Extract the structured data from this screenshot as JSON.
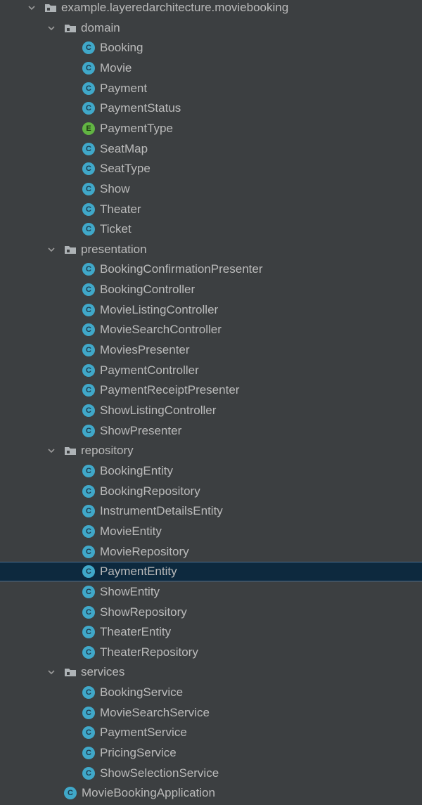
{
  "colors": {
    "background": "#3c3f41",
    "text": "#bbbbbb",
    "selection": "#0d293e",
    "class_icon": "#40a8c9",
    "enum_icon": "#62b543"
  },
  "tree": [
    {
      "label": "example.layeredarchitecture.moviebooking",
      "kind": "package",
      "depth": 0,
      "expanded": true
    },
    {
      "label": "domain",
      "kind": "package",
      "depth": 1,
      "expanded": true
    },
    {
      "label": "Booking",
      "kind": "class",
      "depth": 2
    },
    {
      "label": "Movie",
      "kind": "class",
      "depth": 2
    },
    {
      "label": "Payment",
      "kind": "class",
      "depth": 2
    },
    {
      "label": "PaymentStatus",
      "kind": "class",
      "depth": 2
    },
    {
      "label": "PaymentType",
      "kind": "enum",
      "depth": 2
    },
    {
      "label": "SeatMap",
      "kind": "class",
      "depth": 2
    },
    {
      "label": "SeatType",
      "kind": "class",
      "depth": 2
    },
    {
      "label": "Show",
      "kind": "class",
      "depth": 2
    },
    {
      "label": "Theater",
      "kind": "class",
      "depth": 2
    },
    {
      "label": "Ticket",
      "kind": "class",
      "depth": 2
    },
    {
      "label": "presentation",
      "kind": "package",
      "depth": 1,
      "expanded": true
    },
    {
      "label": "BookingConfirmationPresenter",
      "kind": "class",
      "depth": 2
    },
    {
      "label": "BookingController",
      "kind": "class",
      "depth": 2
    },
    {
      "label": "MovieListingController",
      "kind": "class",
      "depth": 2
    },
    {
      "label": "MovieSearchController",
      "kind": "class",
      "depth": 2
    },
    {
      "label": "MoviesPresenter",
      "kind": "class",
      "depth": 2
    },
    {
      "label": "PaymentController",
      "kind": "class",
      "depth": 2
    },
    {
      "label": "PaymentReceiptPresenter",
      "kind": "class",
      "depth": 2
    },
    {
      "label": "ShowListingController",
      "kind": "class",
      "depth": 2
    },
    {
      "label": "ShowPresenter",
      "kind": "class",
      "depth": 2
    },
    {
      "label": "repository",
      "kind": "package",
      "depth": 1,
      "expanded": true
    },
    {
      "label": "BookingEntity",
      "kind": "class",
      "depth": 2
    },
    {
      "label": "BookingRepository",
      "kind": "class",
      "depth": 2
    },
    {
      "label": "InstrumentDetailsEntity",
      "kind": "class",
      "depth": 2
    },
    {
      "label": "MovieEntity",
      "kind": "class",
      "depth": 2
    },
    {
      "label": "MovieRepository",
      "kind": "class",
      "depth": 2
    },
    {
      "label": "PaymentEntity",
      "kind": "class",
      "depth": 2,
      "selected": true
    },
    {
      "label": "ShowEntity",
      "kind": "class",
      "depth": 2
    },
    {
      "label": "ShowRepository",
      "kind": "class",
      "depth": 2
    },
    {
      "label": "TheaterEntity",
      "kind": "class",
      "depth": 2
    },
    {
      "label": "TheaterRepository",
      "kind": "class",
      "depth": 2
    },
    {
      "label": "services",
      "kind": "package",
      "depth": 1,
      "expanded": true
    },
    {
      "label": "BookingService",
      "kind": "class",
      "depth": 2
    },
    {
      "label": "MovieSearchService",
      "kind": "class",
      "depth": 2
    },
    {
      "label": "PaymentService",
      "kind": "class",
      "depth": 2
    },
    {
      "label": "PricingService",
      "kind": "class",
      "depth": 2
    },
    {
      "label": "ShowSelectionService",
      "kind": "class",
      "depth": 2
    },
    {
      "label": "MovieBookingApplication",
      "kind": "class",
      "depth": 1
    }
  ]
}
